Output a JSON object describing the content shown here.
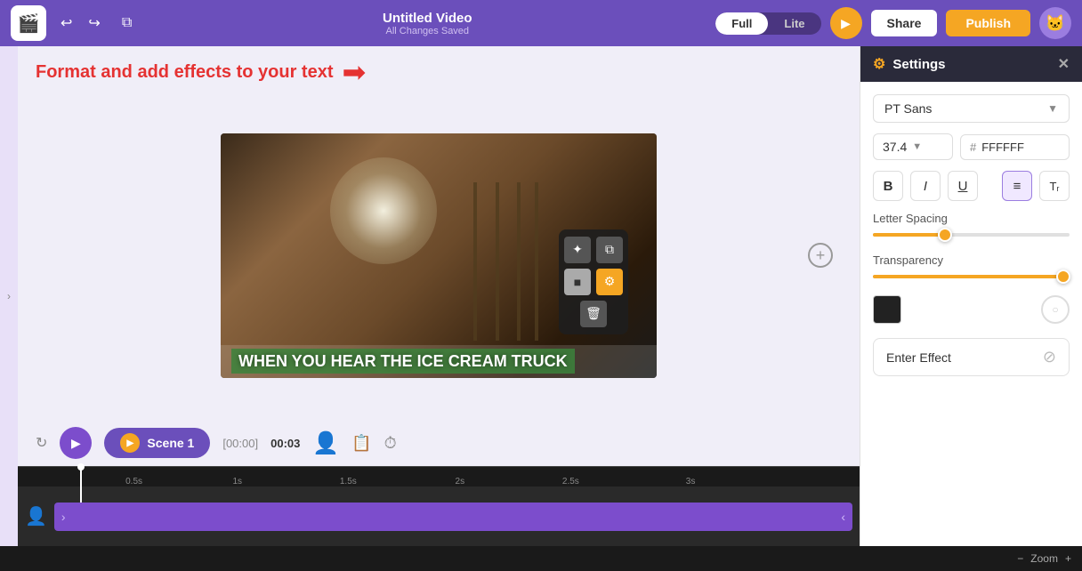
{
  "topbar": {
    "logo_emoji": "🎬",
    "title": "Untitled Video",
    "subtitle": "All Changes Saved",
    "mode_full": "Full",
    "mode_lite": "Lite",
    "share_label": "Share",
    "publish_label": "Publish"
  },
  "instruction": {
    "text": "Format and add effects to your text",
    "arrow": "➡"
  },
  "settings_panel": {
    "header": "Settings",
    "font_name": "PT Sans",
    "font_size": "37.4",
    "color_hex": "FFFFFF",
    "letter_spacing_label": "Letter Spacing",
    "letter_spacing_pct": 35,
    "transparency_label": "Transparency",
    "transparency_pct": 95,
    "enter_effect_label": "Enter Effect"
  },
  "scene": {
    "label": "Scene 1",
    "timecode": "[00:00]",
    "duration": "00:03"
  },
  "video": {
    "caption_text": "WHEN YOU HEAR THE ICE CREAM TRUCK"
  },
  "timeline": {
    "marks": [
      "0.5s",
      "1s",
      "1.5s",
      "2s",
      "2.5s",
      "3s"
    ],
    "zoom_label": "Zoom"
  }
}
